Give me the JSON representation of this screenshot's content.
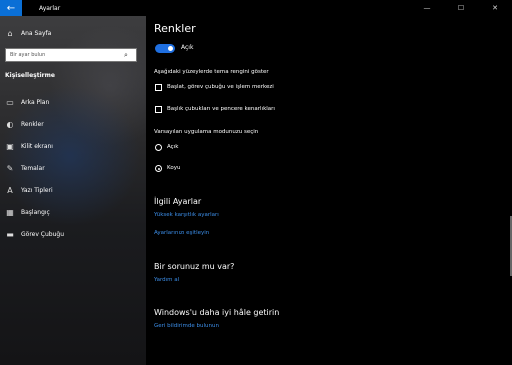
{
  "window": {
    "app_title": "Ayarlar",
    "minimize": "—",
    "maximize": "☐",
    "close": "✕"
  },
  "sidebar": {
    "home": "Ana Sayfa",
    "search_placeholder": "Bir ayar bulun",
    "section": "Kişiselleştirme",
    "items": [
      {
        "label": "Arka Plan",
        "icon": "image-icon"
      },
      {
        "label": "Renkler",
        "icon": "palette-icon"
      },
      {
        "label": "Kilit ekranı",
        "icon": "lock-screen-icon"
      },
      {
        "label": "Temalar",
        "icon": "brush-icon"
      },
      {
        "label": "Yazı Tipleri",
        "icon": "font-icon"
      },
      {
        "label": "Başlangıç",
        "icon": "start-icon"
      },
      {
        "label": "Görev Çubuğu",
        "icon": "taskbar-icon"
      }
    ]
  },
  "main": {
    "title": "Renkler",
    "toggle_label": "Açık",
    "accent_prompt": "Aşağıdaki yüzeylerde tema rengini göster",
    "checkbox_start": "Başlat, görev çubuğu ve işlem merkezi",
    "checkbox_titlebars": "Başlık çubukları ve pencere kenarlıkları",
    "mode_prompt": "Varsayılan uygulama modunuzu seçin",
    "mode_light": "Açık",
    "mode_dark": "Koyu",
    "related_heading": "İlgili Ayarlar",
    "link_contrast": "Yüksek karşıtlık ayarları",
    "link_sync": "Ayarlarınızı eşitleyin",
    "question_heading": "Bir sorunuz mu var?",
    "link_help": "Yardım al",
    "improve_heading": "Windows'u daha iyi hâle getirin",
    "link_feedback": "Geri bildirimde bulunun"
  },
  "colors": {
    "accent": "#1f6fe0",
    "link": "#3c8ee8",
    "back_button": "#0a6fd6"
  }
}
